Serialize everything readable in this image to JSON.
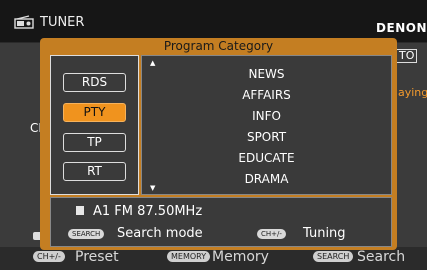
{
  "header": {
    "title": "TUNER",
    "brand": "DENON"
  },
  "background": {
    "auto_label": "TO",
    "playing_label": "aying",
    "channel_label": "CH",
    "bottom": {
      "preset_key": "CH+/-",
      "preset_label": "Preset",
      "memory_key": "MEMORY",
      "memory_label": "Memory",
      "search_key": "SEARCH",
      "search_label": "Search"
    }
  },
  "modal": {
    "title": "Program Category",
    "categories": [
      {
        "label": "RDS",
        "active": false
      },
      {
        "label": "PTY",
        "active": true
      },
      {
        "label": "TP",
        "active": false
      },
      {
        "label": "RT",
        "active": false
      }
    ],
    "items": [
      "NEWS",
      "AFFAIRS",
      "INFO",
      "SPORT",
      "EDUCATE",
      "DRAMA"
    ],
    "station": "A1 FM 87.50MHz",
    "search_key": "SEARCH",
    "search_label": "Search mode",
    "tuning_key": "CH+/-",
    "tuning_label": "Tuning"
  },
  "colors": {
    "accent": "#f0931e",
    "modal_border": "#c47e22"
  }
}
